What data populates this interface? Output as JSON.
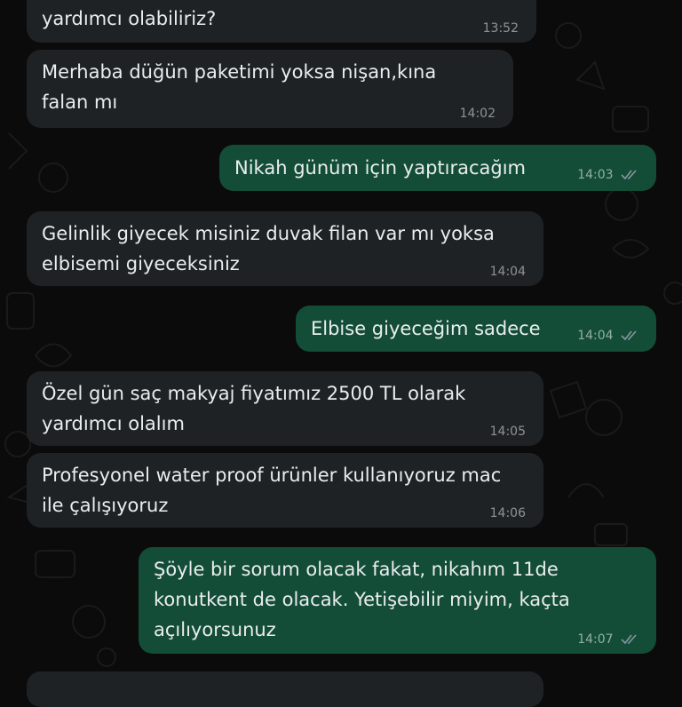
{
  "messages": [
    {
      "direction": "incoming",
      "text": "yardımcı olabiliriz?",
      "time": "13:52"
    },
    {
      "direction": "incoming",
      "text": "Merhaba düğün paketimi yoksa nişan,kına falan mı",
      "time": "14:02"
    },
    {
      "direction": "outgoing",
      "text": "Nikah günüm için yaptıracağım",
      "time": "14:03",
      "status": "read"
    },
    {
      "direction": "incoming",
      "text": "Gelinlik giyecek misiniz duvak filan var mı yoksa elbisemi giyeceksiniz",
      "time": "14:04"
    },
    {
      "direction": "outgoing",
      "text": "Elbise giyeceğim sadece",
      "time": "14:04",
      "status": "read"
    },
    {
      "direction": "incoming",
      "text": "Özel gün saç makyaj fiyatımız 2500 TL olarak yardımcı olalım",
      "time": "14:05"
    },
    {
      "direction": "incoming",
      "text": "Profesyonel water proof ürünler kullanıyoruz mac ile çalışıyoruz",
      "time": "14:06"
    },
    {
      "direction": "outgoing",
      "text": "Şöyle bir sorum olacak fakat, nikahım 11de konutkent de olacak. Yetişebilir miyim, kaçta açılıyorsunuz",
      "time": "14:07",
      "status": "read"
    }
  ],
  "colors": {
    "background": "#0b0b0b",
    "incoming_bubble": "#1f2225",
    "outgoing_bubble": "#134d37",
    "text": "#e9edef",
    "read_ticks": "#8696a0"
  },
  "icons": {
    "read_receipt": "double-check-icon",
    "background_pattern": "doodle-pattern"
  }
}
